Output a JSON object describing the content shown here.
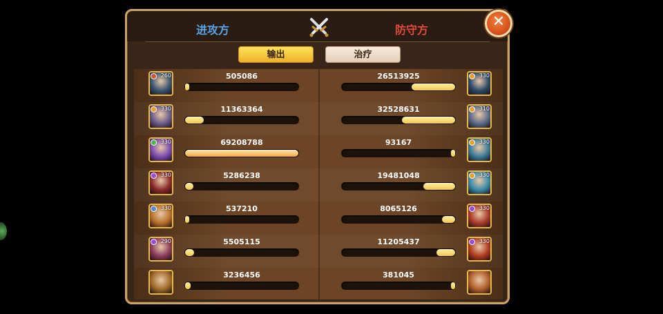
{
  "header": {
    "attacker_label": "进攻方",
    "defender_label": "防守方",
    "close_symbol": "✕"
  },
  "tabs": [
    {
      "label": "输出",
      "active": true
    },
    {
      "label": "治疗",
      "active": false
    }
  ],
  "colors": {
    "attacker": "#58a3e8",
    "defender": "#e04a3a",
    "bar_fill": "#f2c94a"
  },
  "rows": [
    {
      "left": {
        "value": "505086",
        "level": "260",
        "gem": "#d8532a",
        "hero": "#3a5470",
        "fill": 0.007
      },
      "right": {
        "value": "26513925",
        "level": "330",
        "gem": "#e8a02a",
        "hero": "#2c4a6a",
        "fill": 0.383
      }
    },
    {
      "left": {
        "value": "11363364",
        "level": "330",
        "gem": "#e8a02a",
        "hero": "#6b5a8a",
        "fill": 0.164
      },
      "right": {
        "value": "32528631",
        "level": "310",
        "gem": "#e8a02a",
        "hero": "#5a6a8a",
        "fill": 0.47
      }
    },
    {
      "left": {
        "value": "69208788",
        "level": "330",
        "gem": "#4bb848",
        "hero": "#7a4ab0",
        "fill": 1.0,
        "top": true
      },
      "right": {
        "value": "93167",
        "level": "330",
        "gem": "#e8a02a",
        "hero": "#3a7a9a",
        "fill": 0.001
      }
    },
    {
      "left": {
        "value": "5286238",
        "level": "330",
        "gem": "#9a4ad8",
        "hero": "#8a2a2a",
        "fill": 0.076
      },
      "right": {
        "value": "19481048",
        "level": "330",
        "gem": "#e8a02a",
        "hero": "#3a8aaa",
        "fill": 0.281
      }
    },
    {
      "left": {
        "value": "537210",
        "level": "330",
        "gem": "#4a8ad8",
        "hero": "#b8702a",
        "fill": 0.008
      },
      "right": {
        "value": "8065126",
        "level": "330",
        "gem": "#9a4ad8",
        "hero": "#aa3a2a",
        "fill": 0.117
      }
    },
    {
      "left": {
        "value": "5505115",
        "level": "290",
        "gem": "#9a4ad8",
        "hero": "#8a3a5a",
        "fill": 0.08
      },
      "right": {
        "value": "11205437",
        "level": "330",
        "gem": "#9a4ad8",
        "hero": "#b03a20",
        "fill": 0.162
      }
    },
    {
      "left": {
        "value": "3236456",
        "level": "",
        "gem": "",
        "hero": "#a06a2a",
        "fill": 0.047
      },
      "right": {
        "value": "381045",
        "level": "",
        "gem": "",
        "hero": "#b0602a",
        "fill": 0.006
      }
    }
  ]
}
